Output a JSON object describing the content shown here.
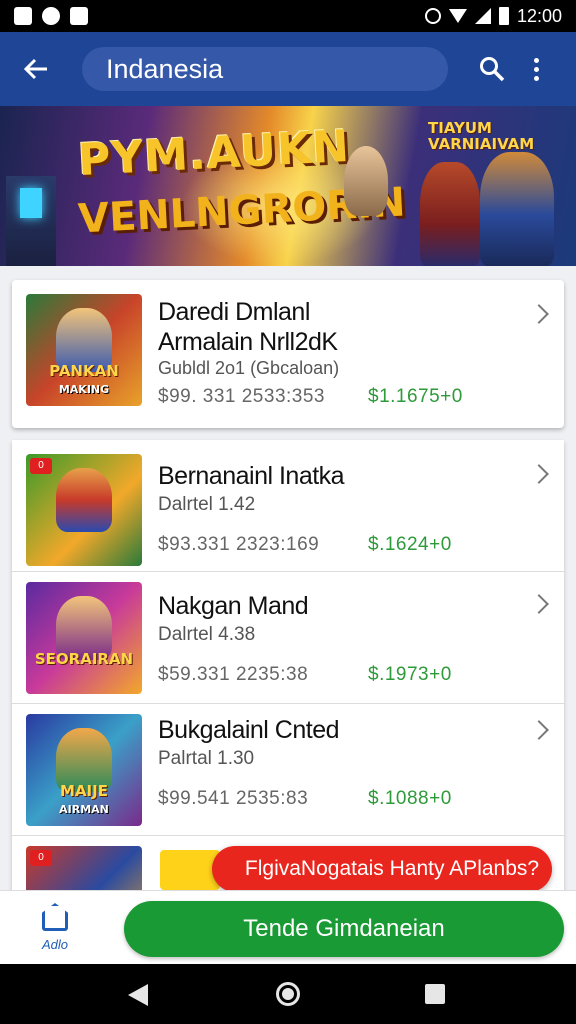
{
  "status_bar": {
    "time": "12:00"
  },
  "app_bar": {
    "search_text": "Indanesia"
  },
  "banner": {
    "title_line1": "PYM.AUKN",
    "title_line2": "VENLNGRORIN",
    "tag_line1": "TIAYUM",
    "tag_line2": "VARNIAIVAM"
  },
  "featured": {
    "thumb_text": "PANKAN",
    "thumb_text2": "MAKING",
    "title_line1": "Daredi    Dmlanl",
    "title_line2": "Armalain Nrll2dK",
    "subtitle": "Gubldl 2o1 (Gbcaloan)",
    "price": "$99. 331  2533:353",
    "amount": "$1.1675+0"
  },
  "items": [
    {
      "title": "Bernanainl Inatka",
      "subtitle": "Dalrtel 1.42",
      "price": "$93.331  2323:169",
      "amount": "$.1624+0",
      "thumb_text": "",
      "thumb_text2": "",
      "badge": "0"
    },
    {
      "title": "Nakgan Mand",
      "subtitle": "Dalrtel 4.38",
      "price": "$59.331  2235:38",
      "amount": "$.1973+0",
      "thumb_text": "SEORAIRAN",
      "thumb_text2": "",
      "badge": ""
    },
    {
      "title": "Bukgalainl Cnted",
      "subtitle": "Palrtal 1.30",
      "price": "$99.541  2535:83",
      "amount": "$.1088+0",
      "thumb_text": "MAIJE",
      "thumb_text2": "AIRMAN",
      "badge": ""
    },
    {
      "title": "",
      "subtitle": "",
      "price": "",
      "amount": "",
      "thumb_text": "",
      "thumb_text2": "",
      "badge": "0"
    }
  ],
  "toast": {
    "label": "FlgivaNogatais Hanty APlanbs?"
  },
  "bottom_bar": {
    "home_label": "Adlo",
    "cta_label": "Tende Gimdaneian"
  },
  "colors": {
    "app_bar": "#1f4596",
    "cta": "#1a9a34",
    "toast": "#e8261e",
    "amount": "#2e9a3a"
  },
  "icons": [
    "back-arrow-icon",
    "search-icon",
    "more-vert-icon",
    "chevron-right-icon",
    "home-icon",
    "nav-back-icon",
    "nav-home-icon",
    "nav-recent-icon"
  ]
}
